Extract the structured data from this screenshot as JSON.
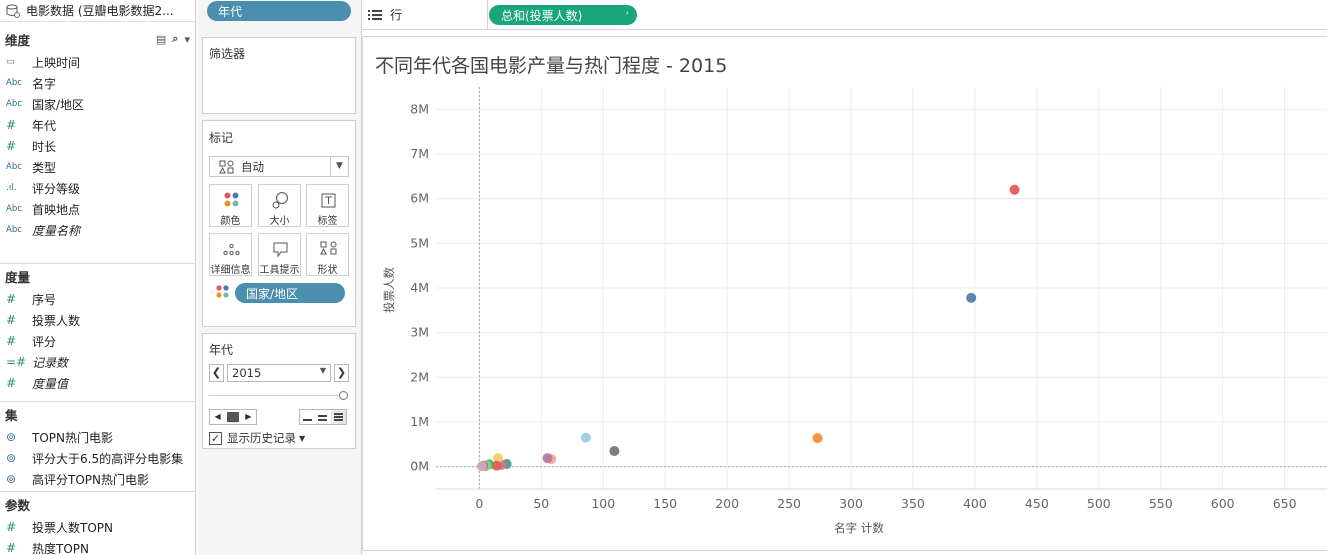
{
  "datasource": {
    "name": "电影数据 (豆瓣电影数据2..."
  },
  "dimensions": {
    "header": "维度",
    "items": [
      {
        "icon": "calendar-icon",
        "glyph": "▭",
        "label": "上映时间",
        "italic": false
      },
      {
        "icon": "abc-icon",
        "glyph": "Abc",
        "label": "名字",
        "italic": false
      },
      {
        "icon": "abc-icon",
        "glyph": "Abc",
        "label": "国家/地区",
        "italic": false
      },
      {
        "icon": "hash-icon",
        "glyph": "#",
        "label": "年代",
        "italic": false
      },
      {
        "icon": "hash-icon",
        "glyph": "#",
        "label": "时长",
        "italic": false
      },
      {
        "icon": "abc-icon",
        "glyph": "Abc",
        "label": "类型",
        "italic": false
      },
      {
        "icon": "bin-icon",
        "glyph": ".ıl.",
        "label": "评分等级",
        "italic": false
      },
      {
        "icon": "abc-icon",
        "glyph": "Abc",
        "label": "首映地点",
        "italic": false
      },
      {
        "icon": "abc-icon",
        "glyph": "Abc",
        "label": "度量名称",
        "italic": true
      }
    ]
  },
  "measures": {
    "header": "度量",
    "items": [
      {
        "icon": "hash-icon",
        "glyph": "#",
        "label": "序号",
        "italic": false
      },
      {
        "icon": "hash-icon",
        "glyph": "#",
        "label": "投票人数",
        "italic": false
      },
      {
        "icon": "hash-icon",
        "glyph": "#",
        "label": "评分",
        "italic": false
      },
      {
        "icon": "calc-hash-icon",
        "glyph": "=#",
        "label": "记录数",
        "italic": true
      },
      {
        "icon": "hash-icon",
        "glyph": "#",
        "label": "度量值",
        "italic": true
      }
    ]
  },
  "sets": {
    "header": "集",
    "items": [
      {
        "icon": "set-icon",
        "glyph": "⊚",
        "label": "TOPN热门电影"
      },
      {
        "icon": "set-icon",
        "glyph": "⊚",
        "label": "评分大于6.5的高评分电影集"
      },
      {
        "icon": "set-icon",
        "glyph": "⊚",
        "label": "高评分TOPN热门电影"
      }
    ]
  },
  "parameters": {
    "header": "参数",
    "items": [
      {
        "icon": "hash-icon",
        "glyph": "#",
        "label": "投票人数TOPN"
      },
      {
        "icon": "hash-icon",
        "glyph": "#",
        "label": "热度TOPN"
      }
    ]
  },
  "pages_pill": "年代",
  "filters": {
    "title": "筛选器"
  },
  "marks": {
    "title": "标记",
    "type": "自动",
    "buttons": [
      "颜色",
      "大小",
      "标签",
      "详细信息",
      "工具提示",
      "形状"
    ],
    "color_pill": "国家/地区"
  },
  "pages_card": {
    "title": "年代",
    "value": "2015",
    "show_history": "显示历史记录"
  },
  "shelves": {
    "rows_label": "行",
    "rows_pill": "总和(投票人数)"
  },
  "view": {
    "title": "不同年代各国电影产量与热门程度 - 2015"
  },
  "chart_data": {
    "type": "scatter",
    "title": "不同年代各国电影产量与热门程度 - 2015",
    "xlabel": "名字 计数",
    "ylabel": "投票人数",
    "xlim": [
      -35,
      685
    ],
    "ylim": [
      -500000,
      8500000
    ],
    "x_ticks": [
      0,
      50,
      100,
      150,
      200,
      250,
      300,
      350,
      400,
      450,
      500,
      550,
      600,
      650
    ],
    "x_tick_labels": [
      "0",
      "50",
      "100",
      "150",
      "200",
      "250",
      "300",
      "350",
      "400",
      "450",
      "500",
      "550",
      "600",
      "650"
    ],
    "y_ticks": [
      0,
      1000000,
      2000000,
      3000000,
      4000000,
      5000000,
      6000000,
      7000000,
      8000000
    ],
    "y_tick_labels": [
      "0M",
      "1M",
      "2M",
      "3M",
      "4M",
      "5M",
      "6M",
      "7M",
      "8M"
    ],
    "grid": true,
    "points": [
      {
        "x": 432,
        "y": 6200000,
        "color": "#e15759"
      },
      {
        "x": 397,
        "y": 3780000,
        "color": "#4e79a7"
      },
      {
        "x": 273,
        "y": 640000,
        "color": "#f28e2b"
      },
      {
        "x": 109,
        "y": 350000,
        "color": "#79706e"
      },
      {
        "x": 86,
        "y": 650000,
        "color": "#a0cbe8"
      },
      {
        "x": 58,
        "y": 170000,
        "color": "#ff9d9a"
      },
      {
        "x": 55,
        "y": 190000,
        "color": "#b07aa1"
      },
      {
        "x": 22,
        "y": 60000,
        "color": "#499894"
      },
      {
        "x": 18,
        "y": 40000,
        "color": "#d37295"
      },
      {
        "x": 15,
        "y": 190000,
        "color": "#f1ce63"
      },
      {
        "x": 14,
        "y": 20000,
        "color": "#e15759"
      },
      {
        "x": 8,
        "y": 50000,
        "color": "#59a14f"
      },
      {
        "x": 6,
        "y": 30000,
        "color": "#86bcb6"
      },
      {
        "x": 5,
        "y": 10000,
        "color": "#8cd17d"
      },
      {
        "x": 3,
        "y": 20000,
        "color": "#9d7660"
      },
      {
        "x": 2,
        "y": 10000,
        "color": "#d4a6c8"
      }
    ]
  }
}
